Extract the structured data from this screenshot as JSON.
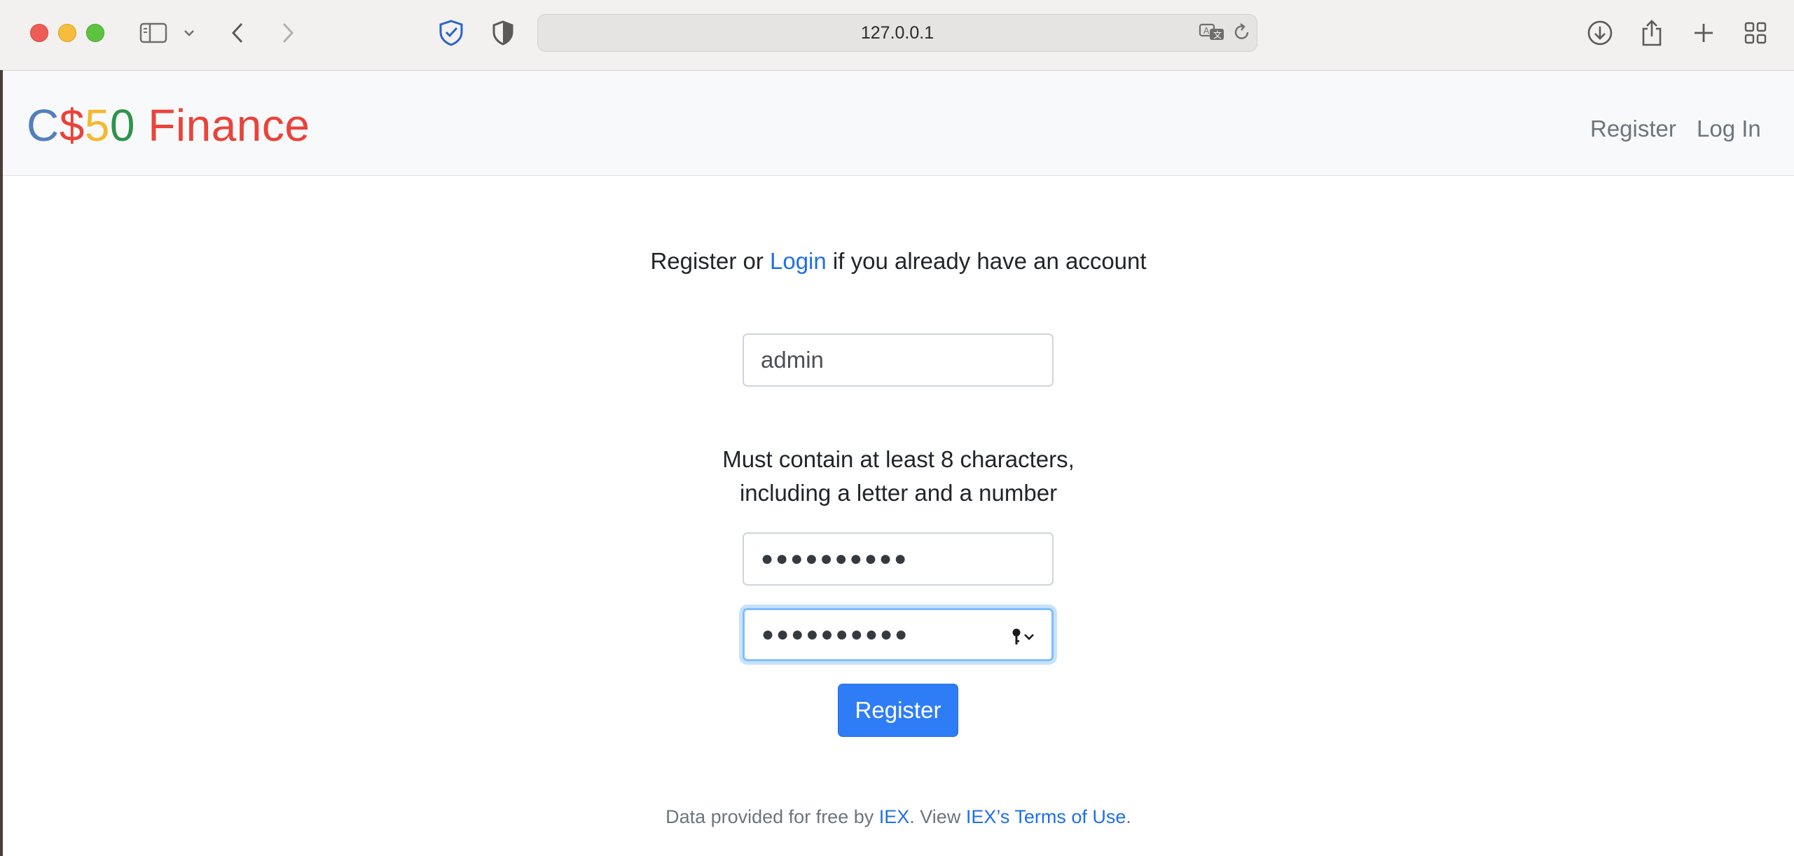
{
  "browser": {
    "url": "127.0.0.1",
    "icons": {
      "sidebar": "sidebar-icon",
      "sidebar_menu": "chevron-down-icon",
      "back": "chevron-left-icon",
      "forward": "chevron-right-icon",
      "privacy": "shield-check-icon",
      "content_blocker": "half-shield-icon",
      "translate": "translate-icon",
      "reload": "reload-icon",
      "downloads": "download-icon",
      "share": "share-icon",
      "new_tab": "plus-icon",
      "tab_overview": "grid-icon"
    }
  },
  "navbar": {
    "brand": {
      "c": "C",
      "dollar": "$",
      "five": "5",
      "zero": "0",
      "finance": " Finance"
    },
    "links": {
      "register": "Register",
      "login": "Log In"
    }
  },
  "form": {
    "intro_before": "Register or ",
    "intro_link": "Login",
    "intro_after": " if you already have an account",
    "username_value": "admin",
    "password_hint_line1": "Must contain at least 8 characters,",
    "password_hint_line2": "including a letter and a number",
    "password_value": "●●●●●●●●●●",
    "confirmation_value": "●●●●●●●●●●",
    "submit_label": "Register"
  },
  "footer": {
    "text_before": "Data provided for free by ",
    "iex_link": "IEX",
    "text_middle": ". View ",
    "terms_link": "IEX’s Terms of Use",
    "text_after": "."
  },
  "colors": {
    "brand_blue": "#537fbe",
    "brand_red": "#ea433b",
    "brand_yellow": "#f5b82e",
    "brand_green": "#2e944b",
    "link": "#1f6fea",
    "button": "#2f7df6"
  }
}
